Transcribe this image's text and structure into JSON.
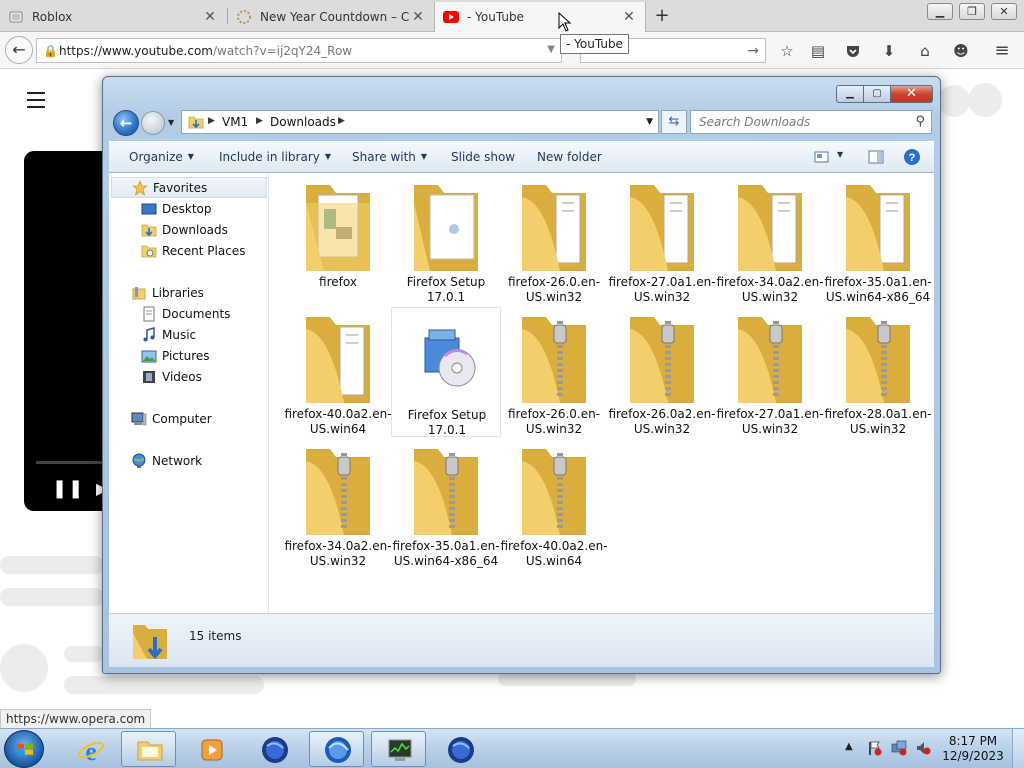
{
  "browser": {
    "tabs": [
      {
        "label": "Roblox",
        "active": false
      },
      {
        "label": "New Year Countdown – Co",
        "active": false
      },
      {
        "label": "- YouTube",
        "active": true
      }
    ],
    "new_tab_symbol": "+",
    "url_host": "https://www.youtube.com",
    "url_path": "/watch?v=ij2qY24_Row",
    "tooltip": "- YouTube",
    "status_url": "https://www.opera.com"
  },
  "explorer": {
    "breadcrumb": [
      "VM1",
      "Downloads"
    ],
    "search_placeholder": "Search Downloads",
    "commands": [
      {
        "label": "Organize",
        "dropdown": true
      },
      {
        "label": "Include in library",
        "dropdown": true
      },
      {
        "label": "Share with",
        "dropdown": true
      },
      {
        "label": "Slide show",
        "dropdown": false
      },
      {
        "label": "New folder",
        "dropdown": false
      }
    ],
    "nav": {
      "favorites": "Favorites",
      "desktop": "Desktop",
      "downloads": "Downloads",
      "recent": "Recent Places",
      "libraries": "Libraries",
      "documents": "Documents",
      "music": "Music",
      "pictures": "Pictures",
      "videos": "Videos",
      "computer": "Computer",
      "network": "Network"
    },
    "files": [
      {
        "name": "firefox",
        "type": "folder-docs"
      },
      {
        "name": "Firefox Setup 17.0.1",
        "type": "folder-setup"
      },
      {
        "name": "firefox-26.0.en-US.win32",
        "type": "folder"
      },
      {
        "name": "firefox-27.0a1.en-US.win32",
        "type": "folder"
      },
      {
        "name": "firefox-34.0a2.en-US.win32",
        "type": "folder"
      },
      {
        "name": "firefox-35.0a1.en-US.win64-x86_64",
        "type": "folder"
      },
      {
        "name": "firefox-40.0a2.en-US.win64",
        "type": "folder"
      },
      {
        "name": "Firefox Setup 17.0.1",
        "type": "installer"
      },
      {
        "name": "firefox-26.0.en-US.win32",
        "type": "zip"
      },
      {
        "name": "firefox-26.0a2.en-US.win32",
        "type": "zip"
      },
      {
        "name": "firefox-27.0a1.en-US.win32",
        "type": "zip"
      },
      {
        "name": "firefox-28.0a1.en-US.win32",
        "type": "zip"
      },
      {
        "name": "firefox-34.0a2.en-US.win32",
        "type": "zip"
      },
      {
        "name": "firefox-35.0a1.en-US.win64-x86_64",
        "type": "zip"
      },
      {
        "name": "firefox-40.0a2.en-US.win64",
        "type": "zip"
      }
    ],
    "item_count": "15 items"
  },
  "taskbar": {
    "time": "8:17 PM",
    "date": "12/9/2023"
  },
  "colors": {
    "folder": "#f2cf6a",
    "folder_dark": "#d9ae3e",
    "explorer_frame": "#b2cce6",
    "close_red": "#c9452e",
    "youtube_red": "#ff0000"
  }
}
